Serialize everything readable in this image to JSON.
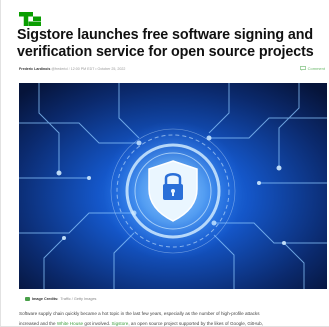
{
  "brand": {
    "logo": "TC",
    "logo_color": "#0a9e01"
  },
  "article": {
    "title": "Sigstore launches free software signing and verification service for open source projects",
    "author": "Frederic Lardinois",
    "handle": "@fredericl",
    "dot": "/",
    "datetime": "12:00 PM EDT • October 25, 2022",
    "comment_label": "Comment",
    "image_icon": "shield-lock-circuit",
    "credits_label": "Image Credits:",
    "credits_value": "Traffic / Getty Images",
    "para_line1": "Software supply chain quickly became a hot topic in the last few years, especially as the number of high-profile attacks",
    "para_line2_a": "increased and the ",
    "para_line2_link1": "White House",
    "para_line2_b": " got involved. ",
    "para_line2_link2": "Sigstore",
    "para_line2_c": ", an open source project supported by the likes of Google, GitHub,"
  },
  "colors": {
    "accent": "#0a9e01",
    "link": "#3e9e3e"
  }
}
